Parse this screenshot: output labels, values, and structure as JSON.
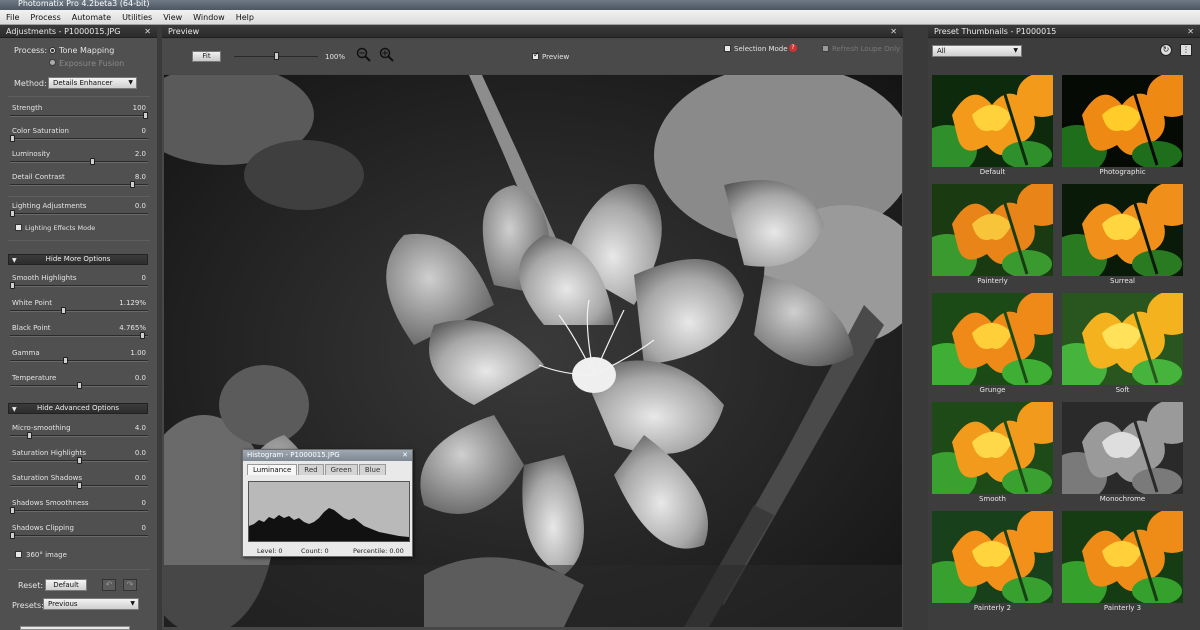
{
  "window": {
    "title": "Photomatix Pro 4.2beta3 (64-bit)"
  },
  "menu": [
    "File",
    "Process",
    "Automate",
    "Utilities",
    "View",
    "Window",
    "Help"
  ],
  "adjustments": {
    "header": "Adjustments - P1000015.JPG",
    "process_label": "Process:",
    "process_options": [
      "Tone Mapping",
      "Exposure Fusion"
    ],
    "method_label": "Method:",
    "method_value": "Details Enhancer",
    "sliders": [
      {
        "label": "Strength",
        "value": "100",
        "level": 1.0
      },
      {
        "label": "Color Saturation",
        "value": "0",
        "level": 0.0
      },
      {
        "label": "Luminosity",
        "value": "2.0",
        "level": 0.6
      },
      {
        "label": "Detail Contrast",
        "value": "8.0",
        "level": 0.9
      },
      {
        "label": "Lighting Adjustments",
        "value": "0.0",
        "level": 0.0
      }
    ],
    "lighting_effects_mode": "Lighting Effects Mode",
    "more_options_btn": "Hide More Options",
    "more_sliders": [
      {
        "label": "Smooth Highlights",
        "value": "0",
        "level": 0.0
      },
      {
        "label": "White Point",
        "value": "1.129%",
        "level": 0.38
      },
      {
        "label": "Black Point",
        "value": "4.765%",
        "level": 0.98
      },
      {
        "label": "Gamma",
        "value": "1.00",
        "level": 0.4
      },
      {
        "label": "Temperature",
        "value": "0.0",
        "level": 0.5
      }
    ],
    "advanced_btn": "Hide Advanced Options",
    "advanced_sliders": [
      {
        "label": "Micro-smoothing",
        "value": "4.0",
        "level": 0.13
      },
      {
        "label": "Saturation Highlights",
        "value": "0.0",
        "level": 0.5
      },
      {
        "label": "Saturation Shadows",
        "value": "0.0",
        "level": 0.5
      },
      {
        "label": "Shadows Smoothness",
        "value": "0",
        "level": 0.0
      },
      {
        "label": "Shadows Clipping",
        "value": "0",
        "level": 0.0
      }
    ],
    "image360": "360° image",
    "reset_label": "Reset:",
    "reset_value": "Default",
    "presets_label": "Presets:",
    "presets_value": "Previous"
  },
  "preview": {
    "header": "Preview",
    "fit_btn": "Fit",
    "zoom": "100%",
    "preview_chk": "Preview",
    "selection_mode": "Selection Mode",
    "refresh_loupe": "Refresh Loupe Only"
  },
  "histogram": {
    "title": "Histogram - P1000015.JPG",
    "tabs": [
      "Luminance",
      "Red",
      "Green",
      "Blue"
    ],
    "level": "Level: 0",
    "count": "Count: 0",
    "percentile": "Percentile: 0.00"
  },
  "presets_panel": {
    "header": "Preset Thumbnails - P1000015",
    "filter": "All",
    "thumbs": [
      "Default",
      "Photographic",
      "Painterly",
      "Surreal",
      "Grunge",
      "Soft",
      "Smooth",
      "Monochrome",
      "Painterly 2",
      "Painterly 3"
    ]
  }
}
